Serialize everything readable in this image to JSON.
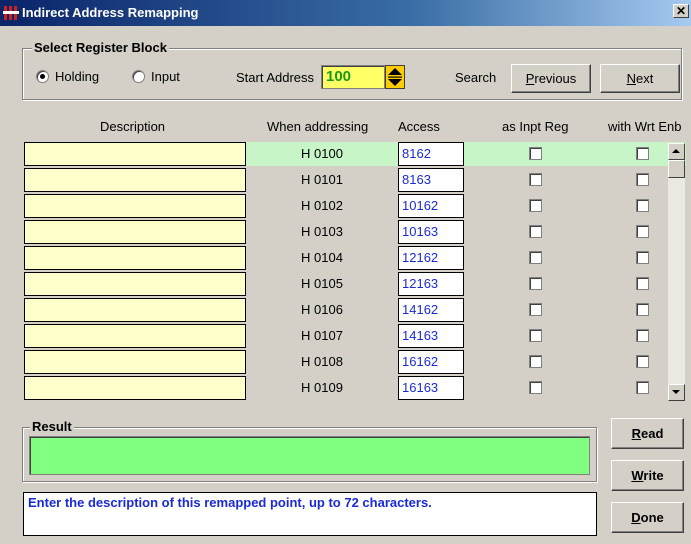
{
  "window": {
    "title": "Indirect Address Remapping",
    "close_glyph": "✕"
  },
  "register_block": {
    "label": "Select Register Block",
    "holding_label": "Holding",
    "input_label": "Input",
    "selected": "Holding",
    "start_address_label": "Start Address",
    "start_address_value": "100",
    "search_label": "Search",
    "previous_label": "Previous",
    "next_label": "Next"
  },
  "columns": {
    "description": "Description",
    "when_addressing": "When addressing",
    "access": "Access",
    "as_inpt_reg": "as Inpt Reg",
    "with_wrt_enb": "with Wrt Enb"
  },
  "rows": [
    {
      "address": "H 0100",
      "access": "8162",
      "as_inpt_reg": false,
      "with_wrt_enb": false,
      "selected": true
    },
    {
      "address": "H 0101",
      "access": "8163",
      "as_inpt_reg": false,
      "with_wrt_enb": false
    },
    {
      "address": "H 0102",
      "access": "10162",
      "as_inpt_reg": false,
      "with_wrt_enb": false
    },
    {
      "address": "H 0103",
      "access": "10163",
      "as_inpt_reg": false,
      "with_wrt_enb": false
    },
    {
      "address": "H 0104",
      "access": "12162",
      "as_inpt_reg": false,
      "with_wrt_enb": false
    },
    {
      "address": "H 0105",
      "access": "12163",
      "as_inpt_reg": false,
      "with_wrt_enb": false
    },
    {
      "address": "H 0106",
      "access": "14162",
      "as_inpt_reg": false,
      "with_wrt_enb": false
    },
    {
      "address": "H 0107",
      "access": "14163",
      "as_inpt_reg": false,
      "with_wrt_enb": false
    },
    {
      "address": "H 0108",
      "access": "16162",
      "as_inpt_reg": false,
      "with_wrt_enb": false
    },
    {
      "address": "H 0109",
      "access": "16163",
      "as_inpt_reg": false,
      "with_wrt_enb": false
    }
  ],
  "result": {
    "label": "Result",
    "value": ""
  },
  "buttons": {
    "read": "Read",
    "write": "Write",
    "done": "Done"
  },
  "status": "Enter the description of this remapped point, up to 72 characters.",
  "colors": {
    "desc_field": "#ffffcc",
    "access_text": "#1a2bd6",
    "result_fill": "#80ff80",
    "start_address_fill": "#ffff66",
    "start_address_text": "#1a9a1a"
  },
  "icons": {
    "app": "app-logo-icon",
    "spin": "spin-up-down-icon"
  }
}
